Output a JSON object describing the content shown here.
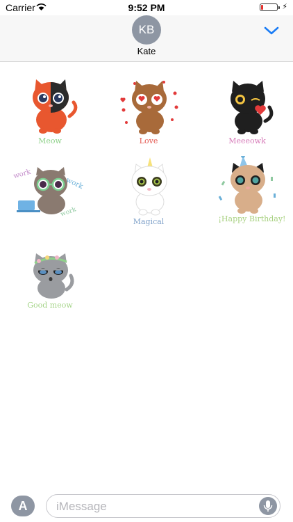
{
  "status_bar": {
    "carrier": "Carrier",
    "time": "9:52 PM",
    "battery_level": 0.15
  },
  "header": {
    "avatar_initials": "KB",
    "contact_name": "Kate"
  },
  "stickers": [
    {
      "label": "Meow",
      "label_color": "#8fd18a"
    },
    {
      "label": "Love",
      "label_color": "#e4574f"
    },
    {
      "label": "Meeeowk",
      "label_color": "#d67ab8"
    },
    {
      "label": "work",
      "label_color": "#c28ac9"
    },
    {
      "label": "Magical",
      "label_color": "#7fa1c9"
    },
    {
      "label": "¡Happy Birthday!",
      "label_color": "#a8d181"
    },
    {
      "label": "Good meow",
      "label_color": "#a6d58a"
    }
  ],
  "input": {
    "placeholder": "iMessage"
  },
  "colors": {
    "accent": "#1a7cf5",
    "badge_gray": "#8e96a3"
  }
}
